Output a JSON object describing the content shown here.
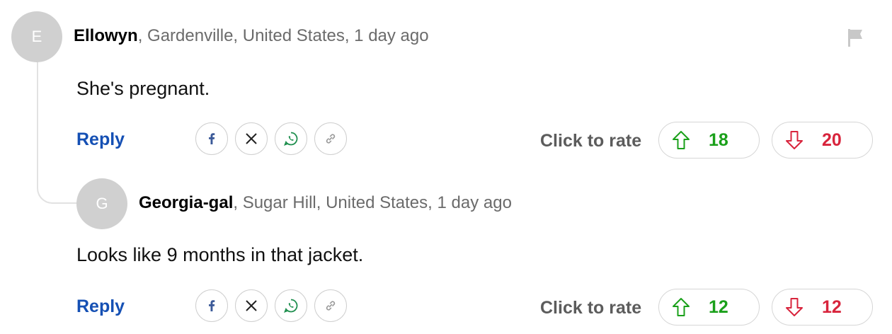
{
  "comments": [
    {
      "avatar_letter": "E",
      "author": "Ellowyn",
      "meta": ", Gardenville, United States, 1 day ago",
      "body": "She's pregnant.",
      "reply_label": "Reply",
      "rate_label": "Click to rate",
      "upvotes": "18",
      "downvotes": "20"
    },
    {
      "avatar_letter": "G",
      "author": "Georgia-gal",
      "meta": ", Sugar Hill, United States, 1 day ago",
      "body": "Looks like 9 months in that jacket.",
      "reply_label": "Reply",
      "rate_label": "Click to rate",
      "upvotes": "12",
      "downvotes": "12"
    }
  ],
  "icons": {
    "share": [
      "facebook-icon",
      "x-icon",
      "whatsapp-icon",
      "link-icon"
    ],
    "flag": "flag-icon",
    "upvote": "arrow-up-icon",
    "downvote": "arrow-down-icon"
  },
  "colors": {
    "reply": "#1550b4",
    "upvote": "#1aa01a",
    "downvote": "#d8243c",
    "facebook": "#3b5998",
    "whatsapp": "#1f8f4e"
  }
}
